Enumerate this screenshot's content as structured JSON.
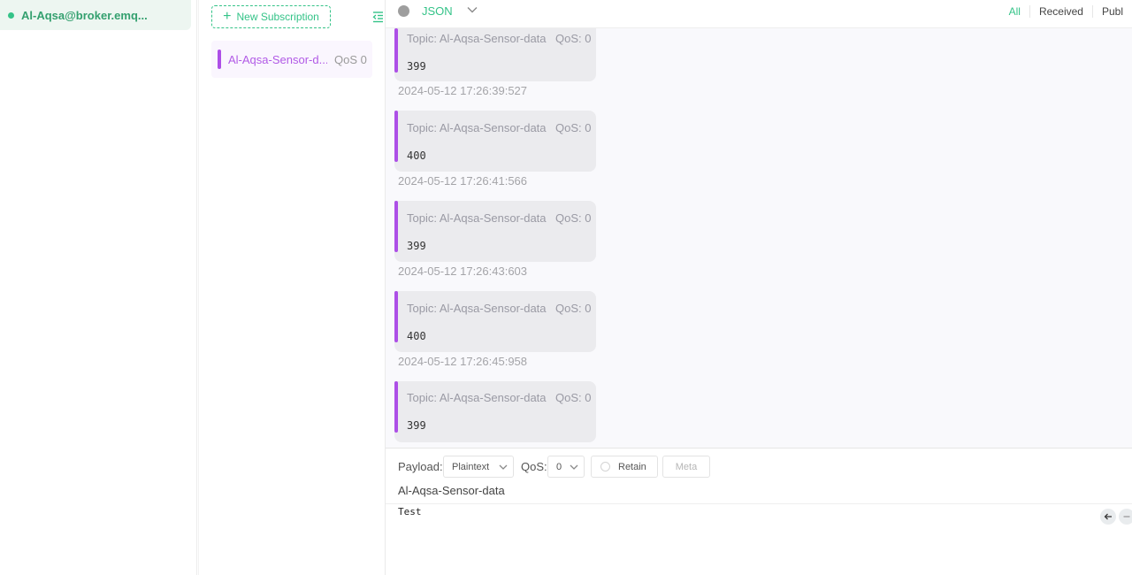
{
  "connections": {
    "items": [
      {
        "name": "Al-Aqsa@broker.emq...",
        "status_color": "#34c388"
      }
    ]
  },
  "subscriptions": {
    "new_button_label": "New Subscription",
    "items": [
      {
        "topic": "Al-Aqsa-Sensor-d...",
        "qos": "QoS 0",
        "color": "#ad4fe7"
      }
    ]
  },
  "topbar": {
    "format": "JSON",
    "filters": [
      "All",
      "Received",
      "Publ"
    ]
  },
  "messages": [
    {
      "topic": "Topic: Al-Aqsa-Sensor-data",
      "qos": "QoS: 0",
      "payload": "399",
      "time": "2024-05-12 17:26:39:527"
    },
    {
      "topic": "Topic: Al-Aqsa-Sensor-data",
      "qos": "QoS: 0",
      "payload": "400",
      "time": "2024-05-12 17:26:41:566"
    },
    {
      "topic": "Topic: Al-Aqsa-Sensor-data",
      "qos": "QoS: 0",
      "payload": "399",
      "time": "2024-05-12 17:26:43:603"
    },
    {
      "topic": "Topic: Al-Aqsa-Sensor-data",
      "qos": "QoS: 0",
      "payload": "400",
      "time": "2024-05-12 17:26:45:958"
    },
    {
      "topic": "Topic: Al-Aqsa-Sensor-data",
      "qos": "QoS: 0",
      "payload": "399",
      "time": ""
    }
  ],
  "publish": {
    "payload_label": "Payload:",
    "payload_type": "Plaintext",
    "qos_label": "QoS:",
    "qos_value": "0",
    "retain_label": "Retain",
    "meta_label": "Meta",
    "topic": "Al-Aqsa-Sensor-data",
    "payload": "Test"
  },
  "colors": {
    "accent": "#34c388",
    "subscription": "#ad4fe7"
  }
}
